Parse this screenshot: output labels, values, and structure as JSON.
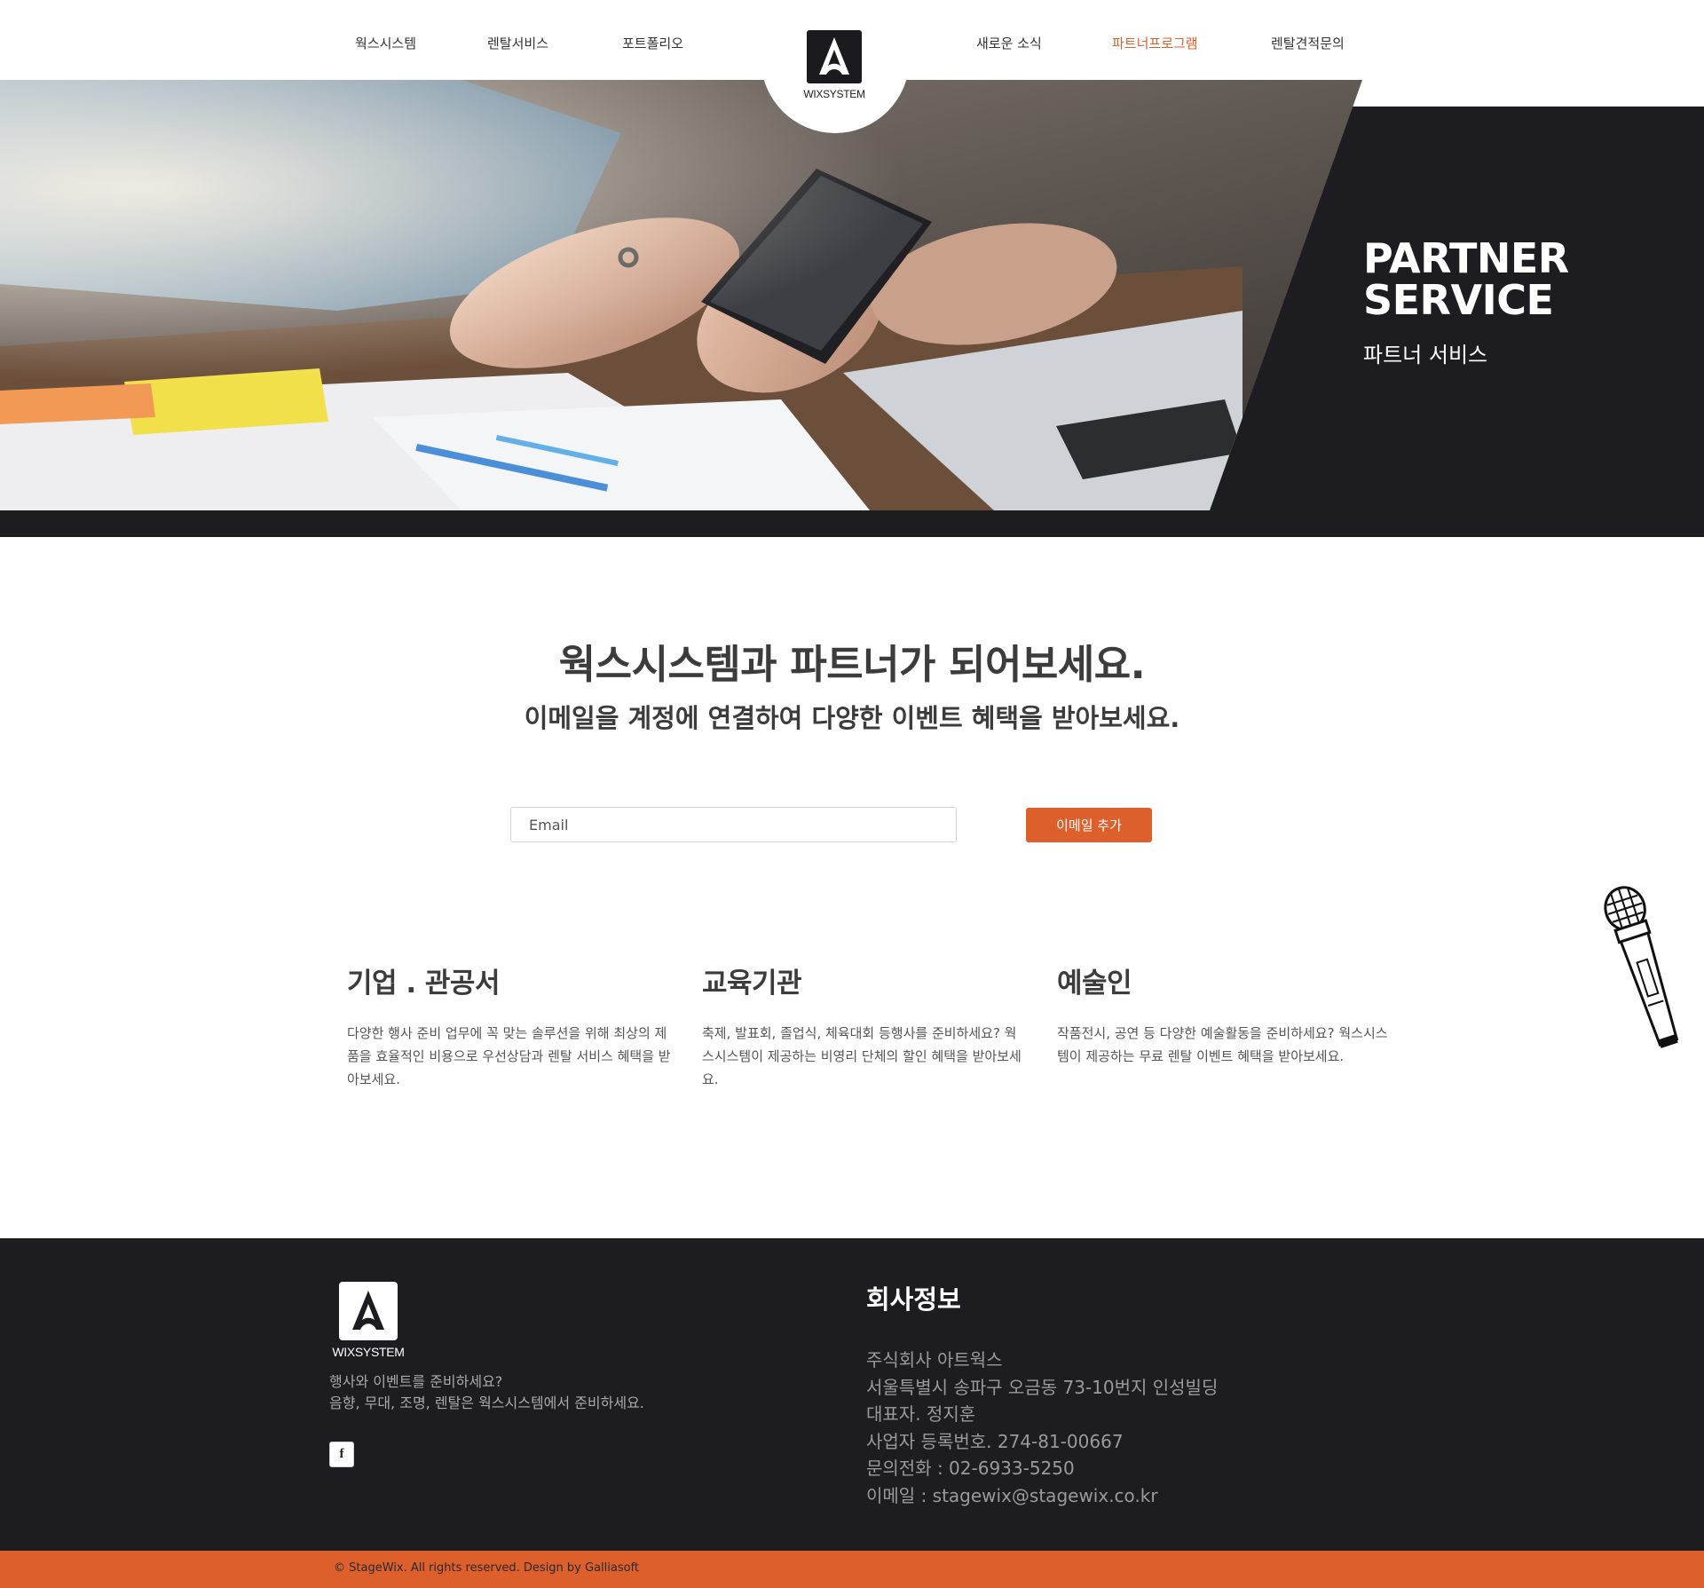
{
  "nav": {
    "left": [
      "웍스시스템",
      "렌탈서비스",
      "포트폴리오"
    ],
    "right": [
      "새로운 소식",
      "파트너프로그램",
      "렌탈견적문의"
    ],
    "active": "파트너프로그램"
  },
  "brand": {
    "logo_text": "WIXSYSTEM",
    "logo_icon": "a-logo-icon"
  },
  "hero": {
    "title_line1": "PARTNER",
    "title_line2": "SERVICE",
    "subtitle": "파트너 서비스"
  },
  "main": {
    "title": "웍스시스템과 파트너가 되어보세요.",
    "subtitle": "이메일을 계정에 연결하여 다양한 이벤트 혜택을 받아보세요.",
    "email_placeholder": "Email",
    "email_button": "이메일 추가"
  },
  "features": [
    {
      "title": "기업 . 관공서",
      "desc": "다양한 행사 준비 업무에 꼭 맞는 솔루션을 위해 최상의 제품을 효율적인 비용으로 우선상담과 렌탈 서비스 혜택을 받아보세요."
    },
    {
      "title": "교육기관",
      "desc": "축제, 발표회, 졸업식, 체육대회 등행사를 준비하세요? 웍스시스템이 제공하는 비영리 단체의 할인 혜택을 받아보세요."
    },
    {
      "title": "예술인",
      "desc": "작품전시, 공연 등 다양한 예술활동을 준비하세요? 웍스시스템이 제공하는 무료 렌탈 이벤트 혜택을 받아보세요."
    }
  ],
  "footer": {
    "logo_text": "WIXSYSTEM",
    "desc_line1": "행사와 이벤트를 준비하세요?",
    "desc_line2": "음향, 무대, 조명, 렌탈은 웍스시스템에서 준비하세요.",
    "social_icon": "facebook-icon",
    "social_glyph": "f",
    "info_title": "회사정보",
    "info": [
      "주식회사 아트웍스",
      "서울특별시 송파구 오금동 73-10번지 인성빌딩",
      "대표자. 정지훈",
      "사업자 등록번호. 274-81-00667",
      "문의전화 : 02-6933-5250",
      "이메일 : stagewix@stagewix.co.kr"
    ],
    "copyright": "© StageWix. All rights reserved. Design by Galliasoft"
  },
  "colors": {
    "accent": "#dd5f2c",
    "dark": "#1c1c21",
    "text": "#3c3c3c"
  }
}
